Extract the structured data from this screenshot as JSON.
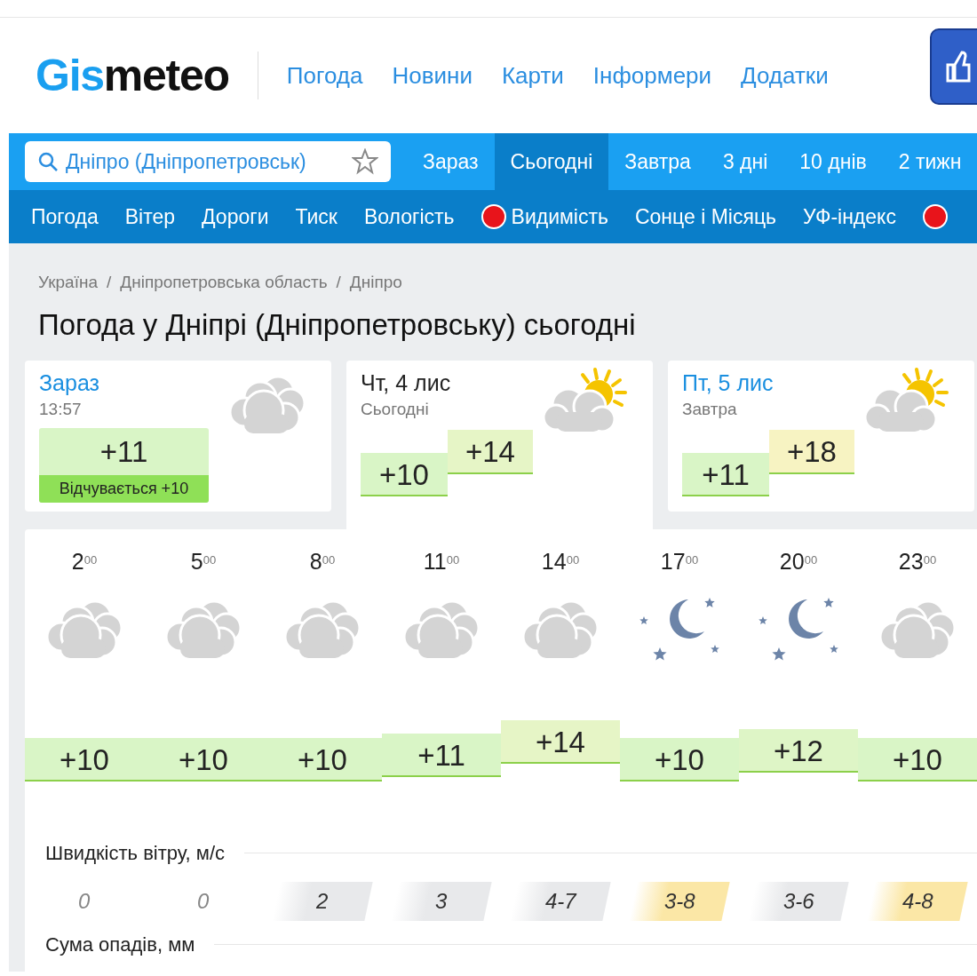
{
  "header": {
    "logo_accent": "Gis",
    "logo_rest": "meteo",
    "nav": [
      "Погода",
      "Новини",
      "Карти",
      "Інформери",
      "Додатки"
    ]
  },
  "search": {
    "value": "Дніпро (Дніпропетровськ)"
  },
  "tabs": [
    {
      "label": "Зараз",
      "selected": false
    },
    {
      "label": "Сьогодні",
      "selected": true
    },
    {
      "label": "Завтра",
      "selected": false
    },
    {
      "label": "3 дні",
      "selected": false
    },
    {
      "label": "10 днів",
      "selected": false
    },
    {
      "label": "2 тижн",
      "selected": false
    }
  ],
  "subnav": [
    {
      "label": "Погода",
      "alert": false
    },
    {
      "label": "Вітер",
      "alert": false
    },
    {
      "label": "Дороги",
      "alert": false
    },
    {
      "label": "Тиск",
      "alert": false
    },
    {
      "label": "Вологість",
      "alert": false
    },
    {
      "label": "Видимість",
      "alert": true
    },
    {
      "label": "Сонце і Місяць",
      "alert": false
    },
    {
      "label": "УФ-індекс",
      "alert": false
    },
    {
      "alert": true
    }
  ],
  "breadcrumbs": {
    "separator": "/",
    "items": [
      "Україна",
      "Дніпропетровська область",
      "Дніпро"
    ]
  },
  "page_title": "Погода у Дніпрі (Дніпропетровську) сьогодні",
  "now_card": {
    "title": "Зараз",
    "time": "13:57",
    "temp": "+11",
    "feels": "Відчувається +10",
    "kind": "cloudy"
  },
  "day_cards": [
    {
      "title": "Чт, 4 лис",
      "subtitle": "Сьогодні",
      "min": "+10",
      "max": "+14",
      "color": "#e6f5c6",
      "kind": "partly-sunny",
      "selected": true
    },
    {
      "title": "Пт, 5 лис",
      "subtitle": "Завтра",
      "min": "+11",
      "max": "+18",
      "color": "#f7f3c2",
      "kind": "partly-sunny",
      "selected": false
    }
  ],
  "hours": [
    {
      "hour": "2",
      "minutes": "00",
      "kind": "cloudy",
      "temp": "+10",
      "color": "#d9f5c6"
    },
    {
      "hour": "5",
      "minutes": "00",
      "kind": "cloudy",
      "temp": "+10",
      "color": "#d9f5c6"
    },
    {
      "hour": "8",
      "minutes": "00",
      "kind": "cloudy",
      "temp": "+10",
      "color": "#d9f5c6"
    },
    {
      "hour": "11",
      "minutes": "00",
      "kind": "cloudy",
      "temp": "+11",
      "color": "#d9f5c6"
    },
    {
      "hour": "14",
      "minutes": "00",
      "kind": "cloudy",
      "temp": "+14",
      "color": "#e6f5c6"
    },
    {
      "hour": "17",
      "minutes": "00",
      "kind": "night",
      "temp": "+10",
      "color": "#d9f5c6"
    },
    {
      "hour": "20",
      "minutes": "00",
      "kind": "night",
      "temp": "+12",
      "color": "#def5c6"
    },
    {
      "hour": "23",
      "minutes": "00",
      "kind": "cloudy",
      "temp": "+10",
      "color": "#d9f5c6"
    }
  ],
  "wind": {
    "title": "Швидкість вітру, м/с",
    "values": [
      {
        "value": "0"
      },
      {
        "value": "0"
      },
      {
        "value": "2",
        "color": "#e8e9eb"
      },
      {
        "value": "3",
        "color": "#e8e9eb"
      },
      {
        "value": "4-7",
        "color": "#e8e9eb"
      },
      {
        "value": "3-8",
        "color": "#fbe7a6"
      },
      {
        "value": "3-6",
        "color": "#e8e9eb"
      },
      {
        "value": "4-8",
        "color": "#fbe7a6"
      }
    ]
  },
  "precipitation": {
    "title": "Сума опадів, мм"
  }
}
